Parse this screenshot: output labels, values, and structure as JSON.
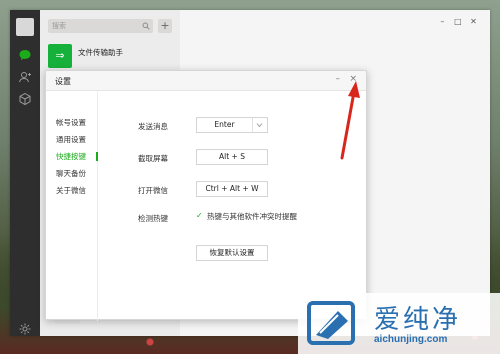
{
  "search": {
    "placeholder": "搜索"
  },
  "add_button": "+",
  "chat_list": [
    {
      "name": "文件传输助手",
      "avatar_glyph": "⇒"
    }
  ],
  "window_controls": {
    "minimize": "–",
    "maximize": "□",
    "close": "✕"
  },
  "dialog": {
    "title": "设置",
    "minimize": "–",
    "close": "×"
  },
  "settings_nav": [
    {
      "label": "帐号设置"
    },
    {
      "label": "通用设置"
    },
    {
      "label": "快捷按键"
    },
    {
      "label": "聊天备份"
    },
    {
      "label": "关于微信"
    }
  ],
  "shortcuts": {
    "send_message": {
      "label": "发送消息",
      "value": "Enter"
    },
    "screenshot": {
      "label": "截取屏幕",
      "value": "Alt + S"
    },
    "open_wechat": {
      "label": "打开微信",
      "value": "Ctrl + Alt + W"
    },
    "detect_hotkey": {
      "label": "检测热键",
      "checkbox_label": "热键与其他软件冲突时提醒",
      "checked": true
    },
    "restore_defaults": "恢复默认设置"
  },
  "watermark": {
    "text": "爱纯净",
    "url": "aichunjing.com"
  },
  "colors": {
    "accent_green": "#1aad19",
    "sidebar_dark": "#2e2e2e",
    "arrow_red": "#d9261c",
    "watermark_blue": "#2a6fb0"
  },
  "icons": [
    "chat-icon",
    "contacts-icon",
    "favorites-icon",
    "settings-gear-icon",
    "search-icon",
    "chevron-down-icon"
  ]
}
